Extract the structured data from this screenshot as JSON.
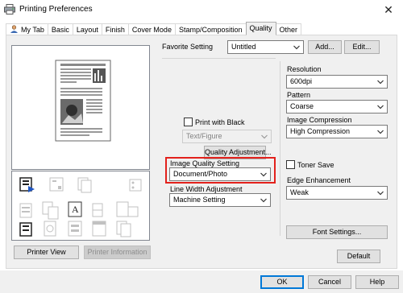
{
  "window": {
    "title": "Printing Preferences",
    "close_glyph": "✕"
  },
  "tabs": [
    {
      "label": "My Tab",
      "active": false
    },
    {
      "label": "Basic",
      "active": false
    },
    {
      "label": "Layout",
      "active": false
    },
    {
      "label": "Finish",
      "active": false
    },
    {
      "label": "Cover Mode",
      "active": false
    },
    {
      "label": "Stamp/Composition",
      "active": false
    },
    {
      "label": "Quality",
      "active": true
    },
    {
      "label": "Other",
      "active": false
    }
  ],
  "favorite": {
    "label": "Favorite Setting",
    "value": "Untitled",
    "add_label": "Add...",
    "edit_label": "Edit..."
  },
  "left": {
    "printer_view_label": "Printer View",
    "printer_info_label": "Printer Information"
  },
  "print_with_black": {
    "label": "Print with Black",
    "checked": false,
    "value": "Text/Figure"
  },
  "quality_adjustment": {
    "label": "Quality Adjustment..."
  },
  "image_quality": {
    "label": "Image Quality Setting",
    "value": "Document/Photo"
  },
  "line_width": {
    "label": "Line Width Adjustment",
    "value": "Machine Setting"
  },
  "resolution": {
    "label": "Resolution",
    "value": "600dpi"
  },
  "pattern": {
    "label": "Pattern",
    "value": "Coarse"
  },
  "image_compression": {
    "label": "Image Compression",
    "value": "High Compression"
  },
  "toner_save": {
    "label": "Toner Save",
    "checked": false
  },
  "edge_enhancement": {
    "label": "Edge Enhancement",
    "value": "Weak"
  },
  "font_settings": {
    "label": "Font Settings..."
  },
  "default_button": {
    "label": "Default"
  },
  "footer": {
    "ok": "OK",
    "cancel": "Cancel",
    "help": "Help"
  },
  "colors": {
    "highlight": "#e3211c",
    "focus": "#0078d7",
    "panel": "#f0f0f0"
  }
}
